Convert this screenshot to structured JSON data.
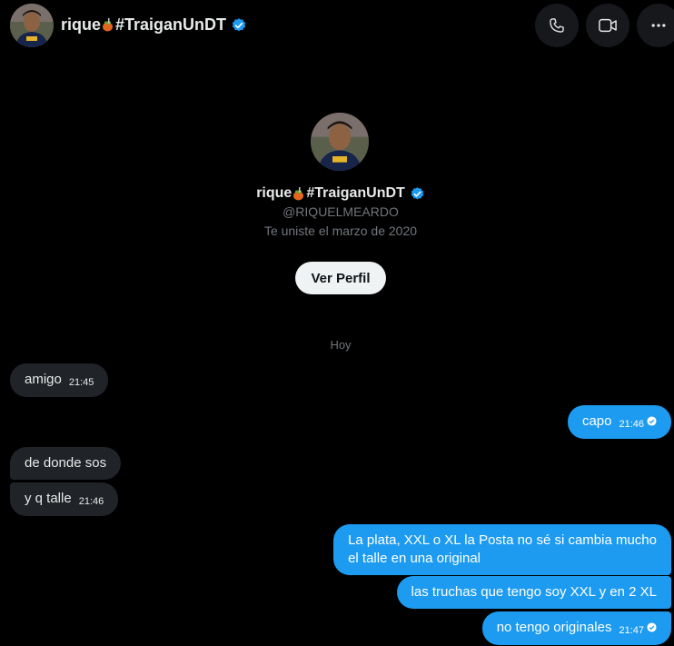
{
  "header": {
    "name": "rique",
    "hashtag": "#TraiganUnDT",
    "call_icon": "phone-icon",
    "video_icon": "video-icon",
    "more_icon": "more-icon"
  },
  "profile": {
    "name": "rique",
    "hashtag": "#TraiganUnDT",
    "handle": "@RIQUELMEARDO",
    "joined": "Te uniste el marzo de 2020",
    "view_button": "Ver Perfil"
  },
  "day_separator": "Hoy",
  "messages": [
    {
      "text": "amigo",
      "time": "21:45",
      "direction": "in"
    },
    {
      "text": "capo",
      "time": "21:46",
      "direction": "out"
    },
    {
      "text": "de donde sos",
      "time": "",
      "direction": "in"
    },
    {
      "text": "y q talle",
      "time": "21:46",
      "direction": "in"
    },
    {
      "text": "La plata, XXL o XL la Posta no sé si cambia mucho",
      "text2": "el talle en una original",
      "time": "",
      "direction": "out"
    },
    {
      "text": "las truchas que tengo soy XXL y en 2 XL",
      "time": "",
      "direction": "out"
    },
    {
      "text": "no tengo originales",
      "time": "21:47",
      "direction": "out"
    }
  ],
  "colors": {
    "background": "#000000",
    "accent": "#1d9bf0",
    "incoming_bubble": "#202327",
    "muted_text": "#71767b"
  }
}
